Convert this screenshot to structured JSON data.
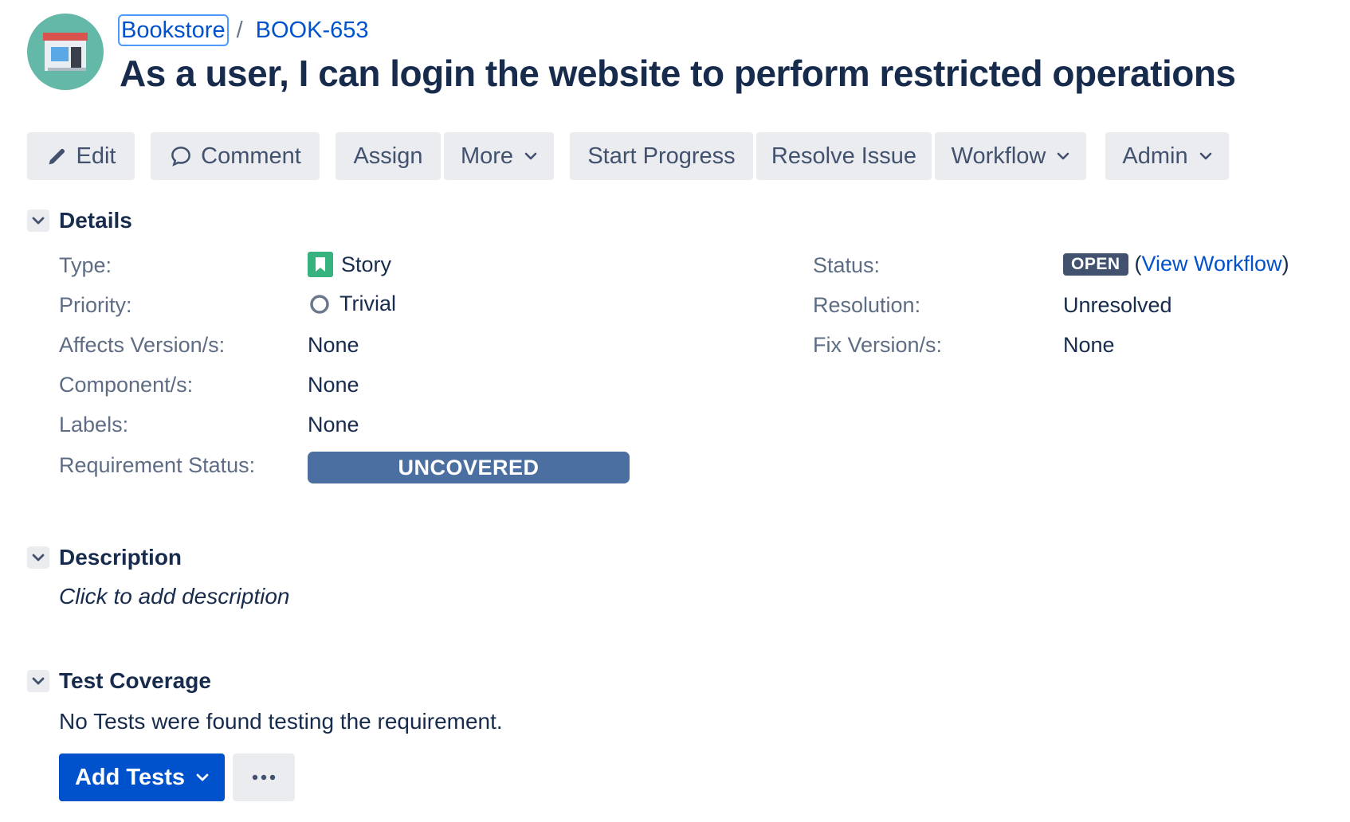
{
  "breadcrumb": {
    "project": "Bookstore",
    "separator": "/",
    "issue_key": "BOOK-653"
  },
  "issue": {
    "title": "As a user, I can login the website to perform restricted operations"
  },
  "toolbar": {
    "edit": "Edit",
    "comment": "Comment",
    "assign": "Assign",
    "more": "More",
    "start_progress": "Start Progress",
    "resolve_issue": "Resolve Issue",
    "workflow": "Workflow",
    "admin": "Admin"
  },
  "details": {
    "heading": "Details",
    "type": {
      "label": "Type:",
      "value": "Story"
    },
    "priority": {
      "label": "Priority:",
      "value": "Trivial"
    },
    "affects_versions": {
      "label": "Affects Version/s:",
      "value": "None"
    },
    "components": {
      "label": "Component/s:",
      "value": "None"
    },
    "labels": {
      "label": "Labels:",
      "value": "None"
    },
    "requirement_status": {
      "label": "Requirement Status:",
      "value": "UNCOVERED"
    },
    "status": {
      "label": "Status:",
      "value": "OPEN",
      "paren_open": "(",
      "link": "View Workflow",
      "paren_close": ")"
    },
    "resolution": {
      "label": "Resolution:",
      "value": "Unresolved"
    },
    "fix_versions": {
      "label": "Fix Version/s:",
      "value": "None"
    }
  },
  "description": {
    "heading": "Description",
    "placeholder": "Click to add description"
  },
  "test_coverage": {
    "heading": "Test Coverage",
    "message": "No Tests were found testing the requirement.",
    "add_tests": "Add Tests"
  },
  "colors": {
    "primary": "#0052cc",
    "text": "#172b4d",
    "label": "#5e6c84",
    "button_bg": "#ebecf0",
    "story_icon": "#36b37e",
    "requirement_badge": "#4a6fa0",
    "status_lozenge": "#42526e"
  },
  "icons": {
    "edit": "pencil-icon",
    "comment": "comment-bubble-icon",
    "dropdown": "chevron-down-icon",
    "story": "story-bookmark-icon",
    "priority": "priority-trivial-circle-icon",
    "more_actions": "ellipsis-icon",
    "avatar": "bookshop-store-icon"
  }
}
